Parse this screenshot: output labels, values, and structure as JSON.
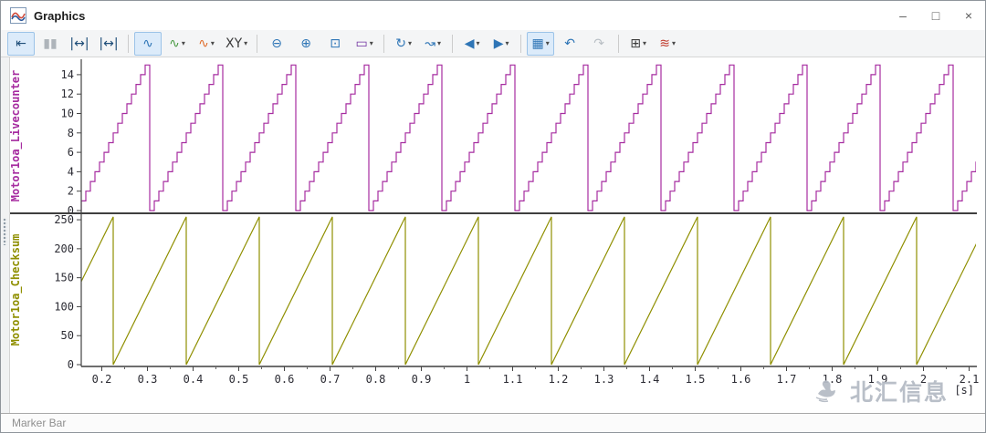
{
  "window": {
    "title": "Graphics",
    "controls": {
      "minimize": "–",
      "maximize": "□",
      "close": "×"
    }
  },
  "toolbar": {
    "dropdown_caret": "▾",
    "items": [
      {
        "type": "button",
        "name": "marker-mode",
        "glyph": "⇤",
        "color": "#1f4e79",
        "active": true
      },
      {
        "type": "button",
        "name": "pause",
        "glyph": "▮▮",
        "color": "#aeb4ba",
        "disabled": true
      },
      {
        "type": "button",
        "name": "fit-time-axis",
        "glyph": "|↔|",
        "color": "#1f4e79"
      },
      {
        "type": "button",
        "name": "fit-value-axis",
        "glyph": "|↔|",
        "color": "#1f4e79"
      },
      {
        "type": "separator"
      },
      {
        "type": "button",
        "name": "display-signals",
        "glyph": "∿",
        "color": "#2e75b6",
        "active": true
      },
      {
        "type": "button",
        "name": "signal-style",
        "glyph": "∿",
        "color": "#4a9a43",
        "dropdown": true
      },
      {
        "type": "button",
        "name": "interpolation-mode",
        "glyph": "∿",
        "color": "#e06c2b",
        "dropdown": true
      },
      {
        "type": "button",
        "name": "xy-mode",
        "glyph": "XY",
        "color": "#3b3b3b",
        "dropdown": true
      },
      {
        "type": "separator"
      },
      {
        "type": "button",
        "name": "zoom-out",
        "glyph": "⊖",
        "color": "#2e75b6"
      },
      {
        "type": "button",
        "name": "zoom-in",
        "glyph": "⊕",
        "color": "#2e75b6"
      },
      {
        "type": "button",
        "name": "zoom-window",
        "glyph": "⊡",
        "color": "#2e75b6"
      },
      {
        "type": "button",
        "name": "select-rectangle",
        "glyph": "▭",
        "color": "#7030a0",
        "dropdown": true
      },
      {
        "type": "separator"
      },
      {
        "type": "button",
        "name": "sync-update",
        "glyph": "↻",
        "color": "#2e75b6",
        "dropdown": true
      },
      {
        "type": "button",
        "name": "goto-sample",
        "glyph": "↝",
        "color": "#2e75b6",
        "dropdown": true
      },
      {
        "type": "separator"
      },
      {
        "type": "button",
        "name": "previous-event",
        "glyph": "◀",
        "color": "#2e75b6",
        "dropdown": true
      },
      {
        "type": "button",
        "name": "next-event",
        "glyph": "▶",
        "color": "#2e75b6",
        "dropdown": true
      },
      {
        "type": "separator"
      },
      {
        "type": "button",
        "name": "color-options",
        "glyph": "▦",
        "color": "#2e75b6",
        "active": true,
        "dropdown": true
      },
      {
        "type": "button",
        "name": "undo",
        "glyph": "↶",
        "color": "#2e75b6"
      },
      {
        "type": "button",
        "name": "redo",
        "glyph": "↷",
        "color": "#b9bfc5",
        "disabled": true
      },
      {
        "type": "separator"
      },
      {
        "type": "button",
        "name": "axis-configuration",
        "glyph": "⊞",
        "color": "#3b3b3b",
        "dropdown": true
      },
      {
        "type": "button",
        "name": "signal-list",
        "glyph": "≋",
        "color": "#c0392b",
        "dropdown": true
      }
    ]
  },
  "chart_data": {
    "type": "line",
    "x_unit_label": "[s]",
    "x_range": [
      0.155,
      2.115
    ],
    "x_ticks": [
      0.2,
      0.3,
      0.4,
      0.5,
      0.6,
      0.7,
      0.8,
      0.9,
      1,
      1.1,
      1.2,
      1.3,
      1.4,
      1.5,
      1.6,
      1.7,
      1.8,
      1.9,
      2,
      2.1
    ],
    "x_minor_tick_step": 0.05,
    "grid": false,
    "panels": [
      {
        "label": "Motor1oa_Livecounter",
        "color": "#a62ca0",
        "y_ticks": [
          0,
          2,
          4,
          6,
          8,
          10,
          12,
          14
        ],
        "y_range": [
          0,
          15.4
        ],
        "signal": {
          "kind": "step_sawtooth",
          "min": 0,
          "max": 15,
          "step": 1,
          "step_duration": 0.01,
          "period": 0.16,
          "phase": 0.145
        }
      },
      {
        "label": "Motor1oa_Checksum",
        "color": "#8f8f00",
        "y_ticks": [
          0,
          50,
          100,
          150,
          200,
          250
        ],
        "y_range": [
          0,
          258
        ],
        "signal": {
          "kind": "sawtooth",
          "min": 0,
          "max": 255,
          "period": 0.16,
          "phase": 0.065
        }
      }
    ]
  },
  "watermark": {
    "text": "北汇信息"
  },
  "status": {
    "marker_bar_label": "Marker Bar"
  }
}
